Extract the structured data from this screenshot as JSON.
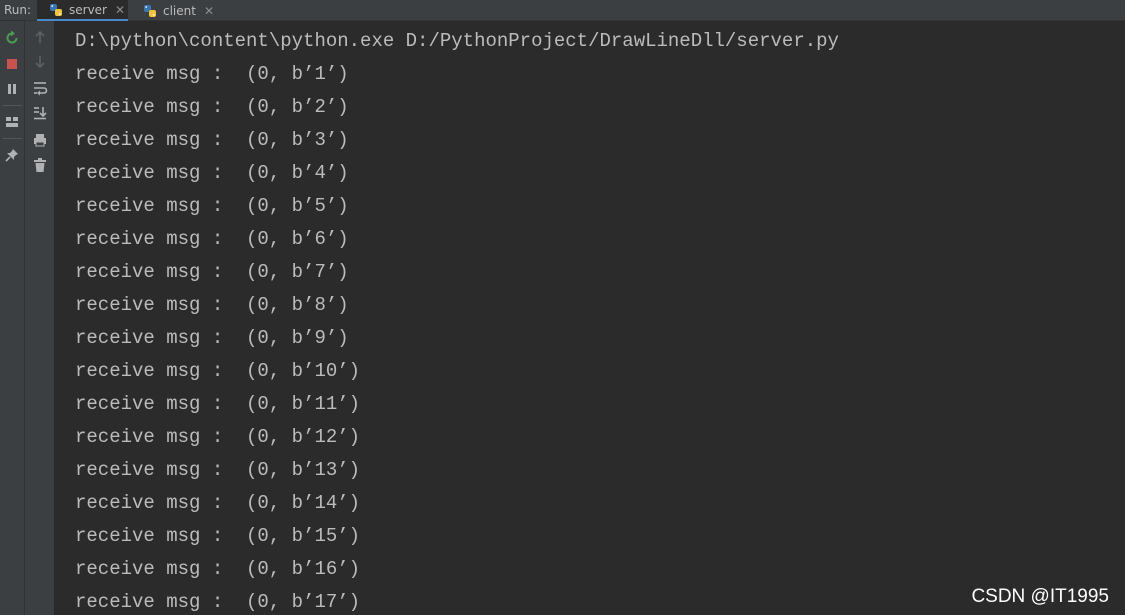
{
  "run_panel": {
    "label": "Run:",
    "tabs": [
      {
        "label": "server",
        "active": true,
        "icon": "python-icon"
      },
      {
        "label": "client",
        "active": false,
        "icon": "python-icon"
      }
    ]
  },
  "toolbar": {
    "left": [
      "rerun-icon",
      "stop-icon",
      "pause-icon",
      "layout-icon",
      "pin-icon"
    ],
    "right": [
      "up-arrow-icon",
      "down-arrow-icon",
      "soft-wrap-icon",
      "scroll-to-end-icon",
      "print-icon",
      "delete-icon"
    ]
  },
  "console": {
    "command": "D:\\python\\content\\python.exe D:/PythonProject/DrawLineDll/server.py",
    "lines": [
      "receive msg :  (0, b’1’)",
      "receive msg :  (0, b’2’)",
      "receive msg :  (0, b’3’)",
      "receive msg :  (0, b’4’)",
      "receive msg :  (0, b’5’)",
      "receive msg :  (0, b’6’)",
      "receive msg :  (0, b’7’)",
      "receive msg :  (0, b’8’)",
      "receive msg :  (0, b’9’)",
      "receive msg :  (0, b’10’)",
      "receive msg :  (0, b’11’)",
      "receive msg :  (0, b’12’)",
      "receive msg :  (0, b’13’)",
      "receive msg :  (0, b’14’)",
      "receive msg :  (0, b’15’)",
      "receive msg :  (0, b’16’)",
      "receive msg :  (0, b’17’)"
    ]
  },
  "watermark": "CSDN @IT1995",
  "colors": {
    "background": "#2b2b2b",
    "panel": "#3c3f41",
    "text": "#bbbbbb",
    "rerun_green": "#499c54",
    "stop_red": "#c75450",
    "tab_accent": "#4a88c7"
  }
}
